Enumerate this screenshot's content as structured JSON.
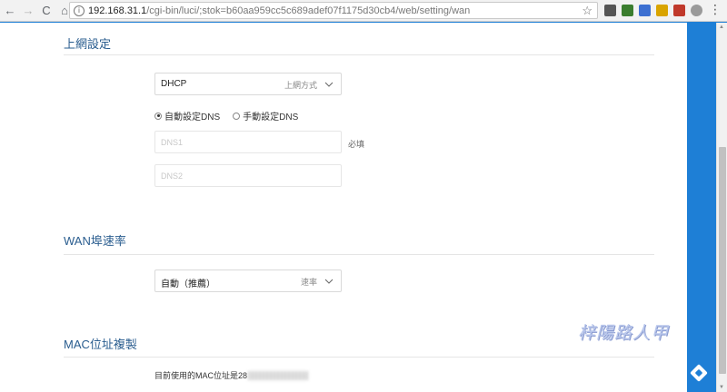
{
  "browser": {
    "url_host": "192.168.31.1",
    "url_path": "/cgi-bin/luci/;stok=b60aa959cc5c689adef07f1175d30cb4/web/setting/wan",
    "nav": {
      "back": "←",
      "forward": "→",
      "reload": "C",
      "home": "⌂"
    },
    "star": "☆",
    "menu": "⋮",
    "extension_colors": [
      "#555555",
      "#3a7d2e",
      "#3c6fd1",
      "#d9a400",
      "#c0392b",
      "#9a9a9a"
    ]
  },
  "wan_settings": {
    "title": "上網設定",
    "connection_type": {
      "value": "DHCP",
      "hint": "上網方式"
    },
    "dns_modes": [
      {
        "label": "自動設定DNS",
        "selected": true
      },
      {
        "label": "手動設定DNS",
        "selected": false
      }
    ],
    "dns1": {
      "placeholder": "DNS1",
      "value": ""
    },
    "dns2": {
      "placeholder": "DNS2",
      "value": ""
    },
    "required_label": "必填"
  },
  "wan_speed": {
    "title": "WAN埠速率",
    "value": "自動（推薦）",
    "hint": "速率"
  },
  "mac_clone": {
    "title": "MAC位址複製",
    "current_mac_label": "目前使用的MAC位址是28"
  },
  "watermark": "梓陽路人甲"
}
